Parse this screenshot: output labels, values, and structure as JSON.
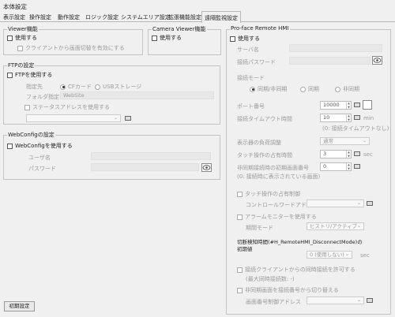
{
  "window": {
    "title": "本体設定"
  },
  "tabs": [
    "表示設定",
    "操作設定",
    "動作設定",
    "ロジック設定",
    "システムエリア設定",
    "拡張機能設定",
    "遠隔監視設定"
  ],
  "viewer": {
    "label": "Viewer機能",
    "use": "使用する",
    "client_switch": "クライアントから画面切替を有効にする"
  },
  "camera": {
    "label": "Camera Viewer機能",
    "use": "使用する"
  },
  "ftp": {
    "label": "FTPの設定",
    "use": "FTPを使用する",
    "dest_label": "指定先",
    "cf": "CFカード",
    "usb": "USBストレージ",
    "folder_label": "フォルダ指定",
    "folder_value": "WebSite",
    "status_addr": "ステータスアドレスを使用する"
  },
  "webconfig": {
    "label": "WebConfigの設定",
    "use": "WebConfigを使用する",
    "user_label": "ユーザ名",
    "password_label": "パスワード"
  },
  "remote": {
    "label": "Pro-face Remote HMI",
    "use": "使用する",
    "server_label": "サーバ名",
    "password_label": "接続パスワード",
    "mode_label": "接続モード",
    "mode_sync_async": "同期/非同期",
    "mode_sync": "同期",
    "mode_async": "非同期",
    "port_label": "ポート番号",
    "port_value": "10000",
    "timeout_label": "接続タイムアウト時間",
    "timeout_value": "10",
    "timeout_unit": "min",
    "timeout_note": "(0: 接続タイムアウトなし)",
    "load_label": "表示器の負荷調整",
    "load_value": "通常",
    "touch_label": "タッチ操作の占有時間",
    "touch_value": "3",
    "touch_unit": "sec",
    "init_screen_label": "非同期接続時の初期画面番号",
    "init_screen_note": "(0: 接続時に表示されている画面)",
    "init_screen_value": "0",
    "touch_occupy": "タッチ操作の占有制御",
    "control_word": "コントロールワードアドレス",
    "alarm_monitor": "アラームモニターを使用する",
    "alarm_period": "期間モード",
    "alarm_period_value": "ヒストリ/アクティブ",
    "disconnect_label": "切断検知時間(#H_RemoteHMI_DisconnectMode)の",
    "disconnect_label2": "初期値",
    "disconnect_value": "0 (使用しない)",
    "disconnect_unit": "sec",
    "multi_client": "接続クライアントからの同時接続を許可する",
    "multi_client_note": "(最大同時接続数: -)",
    "async_switch": "非同期画面を接続番号から切り替える",
    "screen_control": "画面番号制御アドレス"
  },
  "footer": {
    "reset_button": "初期設定"
  }
}
